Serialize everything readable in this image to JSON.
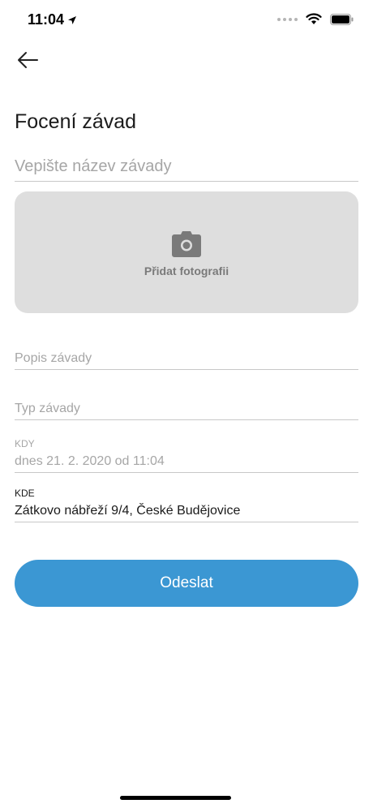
{
  "status_bar": {
    "time": "11:04",
    "icons": [
      "location-arrow-icon",
      "signal-dots-icon",
      "wifi-icon",
      "battery-icon"
    ]
  },
  "nav": {
    "back_icon": "arrow-left-icon"
  },
  "page": {
    "title": "Focení závad"
  },
  "form": {
    "name_placeholder": "Vepište název závady",
    "photo": {
      "icon": "camera-icon",
      "label": "Přidat fotografii"
    },
    "description_placeholder": "Popis závady",
    "type_placeholder": "Typ závady",
    "when": {
      "label": "KDY",
      "value": "dnes 21. 2. 2020 od 11:04"
    },
    "where": {
      "label": "KDE",
      "value": "Zátkovo nábřeží 9/4, České Budějovice"
    },
    "submit_label": "Odeslat"
  },
  "colors": {
    "accent": "#3b97d3",
    "photo_box": "#dedede",
    "placeholder": "#a6a6a6",
    "divider": "#c8c8c8"
  }
}
